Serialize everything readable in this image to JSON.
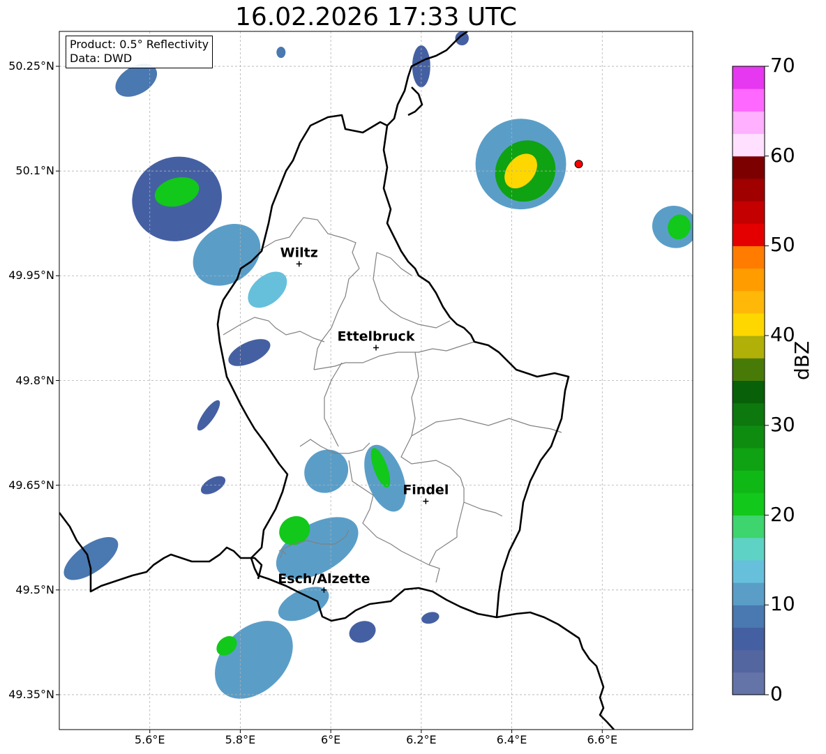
{
  "title": "16.02.2026 17:33 UTC",
  "info_box": {
    "product": "Product: 0.5° Reflectivity",
    "data": "Data: DWD"
  },
  "map": {
    "extent": {
      "lon": [
        5.4,
        6.8
      ],
      "lat": [
        49.3,
        50.3
      ]
    },
    "background_color": "#ffffff",
    "border_color": "#000000",
    "admin_line_color": "#808080",
    "gridline_color": "#b0b0b0",
    "radar_site_color": "#ff0000",
    "x_ticks": [
      {
        "lon": 5.6,
        "label": "5.6°E"
      },
      {
        "lon": 5.8,
        "label": "5.8°E"
      },
      {
        "lon": 6.0,
        "label": "6°E"
      },
      {
        "lon": 6.2,
        "label": "6.2°E"
      },
      {
        "lon": 6.4,
        "label": "6.4°E"
      },
      {
        "lon": 6.6,
        "label": "6.6°E"
      }
    ],
    "y_ticks": [
      {
        "lat": 50.25,
        "label": "50.25°N"
      },
      {
        "lat": 50.1,
        "label": "50.1°N"
      },
      {
        "lat": 49.95,
        "label": "49.95°N"
      },
      {
        "lat": 49.8,
        "label": "49.8°N"
      },
      {
        "lat": 49.65,
        "label": "49.65°N"
      },
      {
        "lat": 49.5,
        "label": "49.5°N"
      },
      {
        "lat": 49.35,
        "label": "49.35°N"
      }
    ],
    "cities": [
      {
        "name": "Wiltz",
        "lon": 5.93,
        "lat": 49.967
      },
      {
        "name": "Ettelbruck",
        "lon": 6.1,
        "lat": 49.847
      },
      {
        "name": "Findel",
        "lon": 6.21,
        "lat": 49.627
      },
      {
        "name": "Esch/Alzette",
        "lon": 5.985,
        "lat": 49.5
      }
    ],
    "radar_site": {
      "lon": 6.548,
      "lat": 50.11
    }
  },
  "colorbar": {
    "label": "dBZ",
    "min": 0,
    "max": 70,
    "step": 2.5,
    "ticks": [
      0,
      10,
      20,
      30,
      40,
      50,
      60,
      70
    ],
    "colors": [
      "#6474a8",
      "#5466a0",
      "#4560a2",
      "#4a78b0",
      "#5a9ec8",
      "#66c0dc",
      "#5ed2c4",
      "#3ed46e",
      "#12c81a",
      "#10b816",
      "#0fa212",
      "#0e8c10",
      "#0c780e",
      "#086008",
      "#487a08",
      "#b0b008",
      "#ffd700",
      "#ffb808",
      "#ff9c00",
      "#ff7c00",
      "#e40000",
      "#c40000",
      "#a00000",
      "#7c0000",
      "#ffe0ff",
      "#ffb0ff",
      "#ff68ff",
      "#e638f0"
    ]
  },
  "precip_cells": [
    {
      "lon": 6.42,
      "lat": 50.11,
      "rx": 0.1,
      "ry": 0.065,
      "rot": 35,
      "dbz": 12
    },
    {
      "lon": 6.43,
      "lat": 50.1,
      "rx": 0.065,
      "ry": 0.045,
      "rot": 38,
      "dbz": 27
    },
    {
      "lon": 6.42,
      "lat": 50.1,
      "rx": 0.03,
      "ry": 0.028,
      "rot": 40,
      "dbz": 41
    },
    {
      "lon": 6.76,
      "lat": 50.02,
      "rx": 0.05,
      "ry": 0.03,
      "rot": 20,
      "dbz": 10
    },
    {
      "lon": 6.77,
      "lat": 50.02,
      "rx": 0.025,
      "ry": 0.018,
      "rot": 20,
      "dbz": 22
    },
    {
      "lon": 5.57,
      "lat": 50.23,
      "rx": 0.05,
      "ry": 0.02,
      "rot": -30,
      "dbz": 8
    },
    {
      "lon": 5.66,
      "lat": 50.06,
      "rx": 0.1,
      "ry": 0.06,
      "rot": -20,
      "dbz": 6
    },
    {
      "lon": 5.66,
      "lat": 50.07,
      "rx": 0.05,
      "ry": 0.02,
      "rot": -15,
      "dbz": 21
    },
    {
      "lon": 5.77,
      "lat": 49.98,
      "rx": 0.08,
      "ry": 0.04,
      "rot": -35,
      "dbz": 11
    },
    {
      "lon": 5.86,
      "lat": 49.93,
      "rx": 0.05,
      "ry": 0.02,
      "rot": -40,
      "dbz": 14
    },
    {
      "lon": 5.82,
      "lat": 49.84,
      "rx": 0.05,
      "ry": 0.015,
      "rot": -25,
      "dbz": 5
    },
    {
      "lon": 5.73,
      "lat": 49.75,
      "rx": 0.04,
      "ry": 0.008,
      "rot": -55,
      "dbz": 7
    },
    {
      "lon": 5.99,
      "lat": 49.67,
      "rx": 0.05,
      "ry": 0.03,
      "rot": -40,
      "dbz": 10
    },
    {
      "lon": 6.12,
      "lat": 49.66,
      "rx": 0.04,
      "ry": 0.05,
      "rot": -20,
      "dbz": 12
    },
    {
      "lon": 6.11,
      "lat": 49.675,
      "rx": 0.015,
      "ry": 0.03,
      "rot": -20,
      "dbz": 22
    },
    {
      "lon": 5.97,
      "lat": 49.56,
      "rx": 0.1,
      "ry": 0.035,
      "rot": -30,
      "dbz": 10
    },
    {
      "lon": 5.92,
      "lat": 49.585,
      "rx": 0.035,
      "ry": 0.02,
      "rot": -30,
      "dbz": 22
    },
    {
      "lon": 5.83,
      "lat": 49.4,
      "rx": 0.1,
      "ry": 0.045,
      "rot": -45,
      "dbz": 10
    },
    {
      "lon": 5.77,
      "lat": 49.42,
      "rx": 0.025,
      "ry": 0.012,
      "rot": -40,
      "dbz": 21
    },
    {
      "lon": 5.94,
      "lat": 49.48,
      "rx": 0.06,
      "ry": 0.02,
      "rot": -25,
      "dbz": 12
    },
    {
      "lon": 6.07,
      "lat": 49.44,
      "rx": 0.03,
      "ry": 0.015,
      "rot": -20,
      "dbz": 7
    },
    {
      "lon": 5.47,
      "lat": 49.545,
      "rx": 0.07,
      "ry": 0.02,
      "rot": -35,
      "dbz": 9
    },
    {
      "lon": 5.74,
      "lat": 49.65,
      "rx": 0.03,
      "ry": 0.01,
      "rot": -30,
      "dbz": 6
    },
    {
      "lon": 6.22,
      "lat": 49.46,
      "rx": 0.02,
      "ry": 0.008,
      "rot": -15,
      "dbz": 5
    },
    {
      "lon": 6.2,
      "lat": 50.25,
      "rx": 0.02,
      "ry": 0.03,
      "rot": 0,
      "dbz": 6
    },
    {
      "lon": 5.89,
      "lat": 50.27,
      "rx": 0.01,
      "ry": 0.008,
      "rot": 0,
      "dbz": 9
    },
    {
      "lon": 6.29,
      "lat": 50.29,
      "rx": 0.015,
      "ry": 0.01,
      "rot": 0,
      "dbz": 6
    }
  ]
}
